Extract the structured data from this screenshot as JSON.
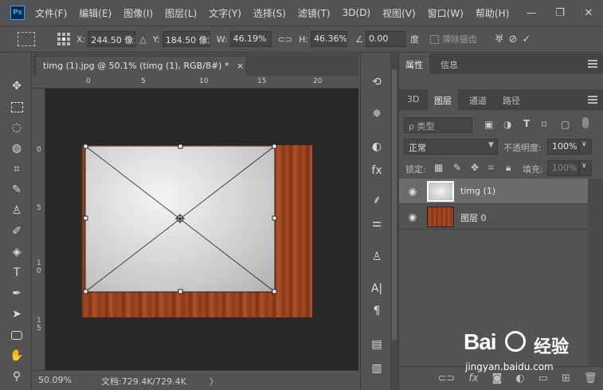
{
  "menubar": {
    "logo": "Ps",
    "items": [
      "文件(F)",
      "编辑(E)",
      "图像(I)",
      "图层(L)",
      "文字(Y)",
      "选择(S)",
      "滤镜(T)",
      "3D(D)",
      "视图(V)",
      "窗口(W)",
      "帮助(H)"
    ],
    "minimize": "—",
    "restore": "❐",
    "close": "✕"
  },
  "options": {
    "x_label": "X:",
    "x_value": "244.50 像素",
    "y_label": "Y:",
    "y_value": "184.50 像素",
    "w_label": "W:",
    "w_value": "46.19%",
    "h_label": "H:",
    "h_value": "46.36%",
    "angle_value": "0.00",
    "angle_unit": "度",
    "interp_label": "薄除锯齿"
  },
  "document": {
    "tab_title": "timg (1).jpg @ 50.1% (timg (1), RGB/8#) *",
    "tab_close": "×",
    "ruler_top": [
      "0",
      "5",
      "10",
      "15",
      "20"
    ],
    "ruler_left": [
      "0",
      "5",
      "1\n0",
      "1\n5"
    ],
    "zoom": "50.09%",
    "doc_info": "文档:729.4K/729.4K",
    "status_arrow": "〉"
  },
  "panels": {
    "top_tabs": [
      "属性",
      "信息"
    ],
    "layer_tabs": [
      "3D",
      "图层",
      "通道",
      "路径"
    ],
    "filter_kind": "ρ 类型",
    "blend_mode": "正常",
    "opacity_label": "不透明度:",
    "opacity_value": "100%",
    "lock_label": "锁定:",
    "fill_label": "填充:",
    "fill_value": "100%",
    "layers": [
      {
        "name": "timg (1)",
        "selected": true
      },
      {
        "name": "图层 0",
        "selected": false
      }
    ]
  },
  "watermark": {
    "brand": "Bai",
    "brand2": "经验",
    "site": "jingyan.baidu.com"
  }
}
